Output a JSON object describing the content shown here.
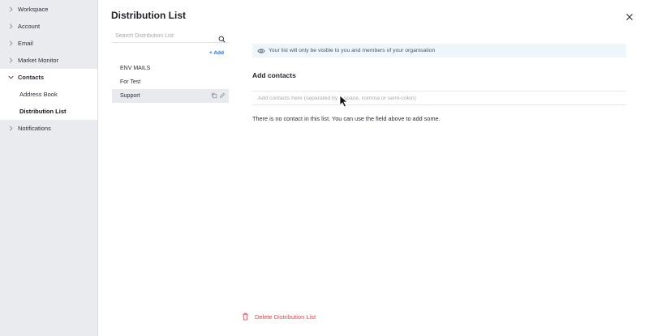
{
  "sidebar": {
    "items": [
      {
        "label": "Workspace"
      },
      {
        "label": "Account"
      },
      {
        "label": "Email"
      },
      {
        "label": "Market Monitor"
      },
      {
        "label": "Contacts"
      },
      {
        "label": "Notifications"
      }
    ],
    "contacts_sub": [
      {
        "label": "Address Book"
      },
      {
        "label": "Distribution List"
      }
    ]
  },
  "main": {
    "title": "Distribution List",
    "search_placeholder": "Search Distribution List",
    "add_label": "+ Add",
    "lists": [
      {
        "label": "ENV MAILS"
      },
      {
        "label": "For Test"
      },
      {
        "label": "Support"
      }
    ],
    "info_text": "Your list will only be visible to you and members of your organisation",
    "add_contacts_heading": "Add contacts",
    "contacts_placeholder": "Add contacts here (separated by a space, comma or semi-colon)",
    "empty_message": "There is no contact in this list. You can use the field above to add some.",
    "delete_label": "Delete Distribution List"
  },
  "colors": {
    "accent": "#2f6bd6",
    "danger": "#e0484e",
    "sidebar_bg": "#e9ebee",
    "info_bg": "#eef5fb"
  }
}
